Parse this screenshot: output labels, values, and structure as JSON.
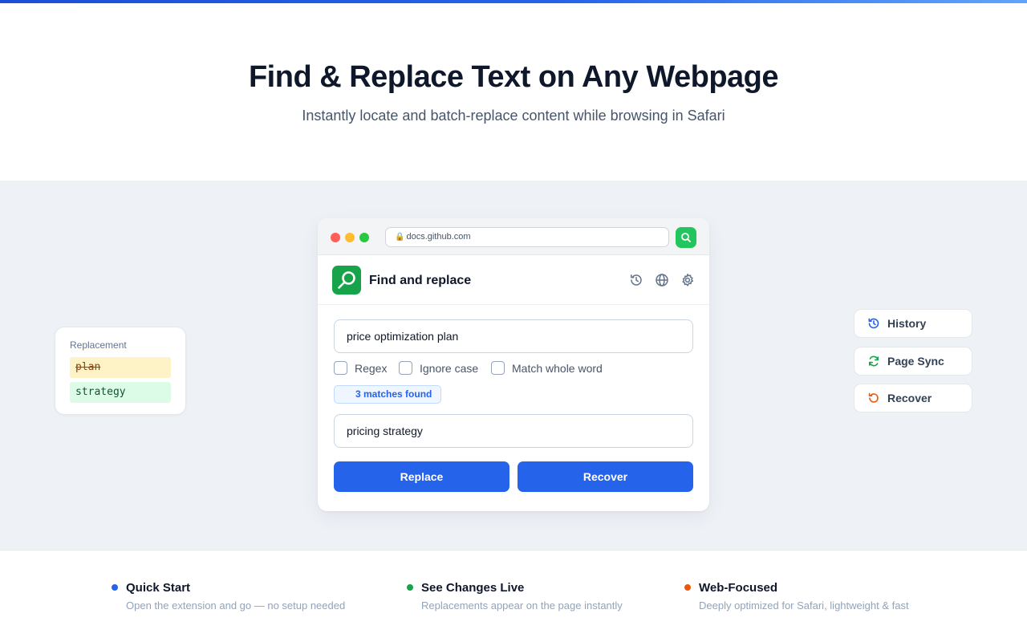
{
  "hero": {
    "title": "Find & Replace Text on Any Webpage",
    "subtitle": "Instantly locate and batch-replace content while browsing in Safari"
  },
  "replacement_card": {
    "label": "Replacement",
    "old_text": "plan",
    "new_text": "strategy"
  },
  "side_actions": [
    {
      "label": "History",
      "icon": "history-icon",
      "color": "#2563eb"
    },
    {
      "label": "Page Sync",
      "icon": "sync-icon",
      "color": "#16a34a"
    },
    {
      "label": "Recover",
      "icon": "recover-icon",
      "color": "#ea580c"
    }
  ],
  "browser": {
    "url": "docs.github.com",
    "extension_icon": "search-icon"
  },
  "app": {
    "title": "Find and replace",
    "header_icons": [
      "history-icon",
      "globe-icon",
      "settings-gear-icon"
    ],
    "find_value": "price optimization plan",
    "options": [
      {
        "label": "Regex",
        "checked": false
      },
      {
        "label": "Ignore case",
        "checked": false
      },
      {
        "label": "Match whole word",
        "checked": false
      }
    ],
    "matches_label": "3 matches found",
    "replace_value": "pricing strategy",
    "replace_button": "Replace",
    "recover_button": "Recover"
  },
  "features": [
    {
      "title": "Quick Start",
      "desc": "Open the extension and go — no setup needed",
      "color": "#2563eb"
    },
    {
      "title": "See Changes Live",
      "desc": "Replacements appear on the page instantly",
      "color": "#16a34a"
    },
    {
      "title": "Web-Focused",
      "desc": "Deeply optimized for Safari, lightweight & fast",
      "color": "#ea580c"
    }
  ],
  "colors": {
    "accent": "#2563eb",
    "brand_green": "#16a34a",
    "background_stage": "#eef1f6"
  }
}
